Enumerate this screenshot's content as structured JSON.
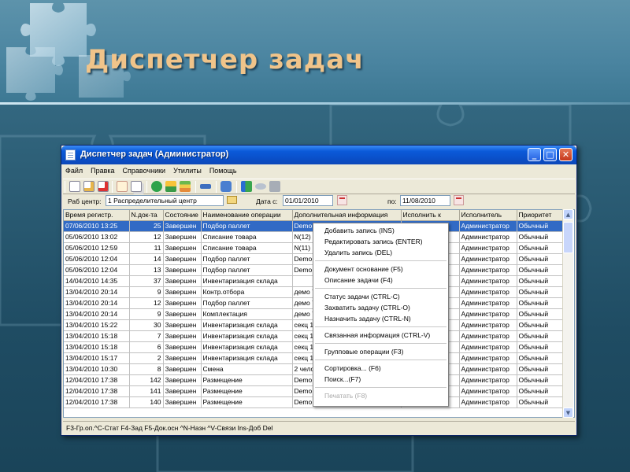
{
  "slide": {
    "title": "Диспетчер задач"
  },
  "window": {
    "title": "Диспетчер задач (Администратор)",
    "controls": {
      "minimize": "_",
      "maximize": "□",
      "close": "✕"
    }
  },
  "menubar": [
    "Файл",
    "Правка",
    "Справочники",
    "Утилиты",
    "Помощь"
  ],
  "toolbar": {
    "icons": [
      "new-doc-icon",
      "edit-doc-icon",
      "delete-doc-icon",
      "doc-base-icon",
      "copy-icon",
      "check-icon",
      "status-icon",
      "task-stack-icon",
      "link-icon",
      "group-icon",
      "sort-icon",
      "view-icon",
      "print-icon"
    ]
  },
  "filters": {
    "work_center_label": "Раб центр:",
    "work_center_value": "1 Распределительный центр",
    "date_from_label": "Дата с:",
    "date_from_value": "01/01/2010",
    "date_to_label": "по:",
    "date_to_value": "11/08/2010"
  },
  "grid": {
    "columns": [
      "Время регистр.",
      "N.док-та",
      "Состояние",
      "Наименование операции",
      "Дополнительная информация",
      "Исполнить к",
      "Исполнитель",
      "Приоритет"
    ],
    "rows": [
      [
        "07/06/2010 13:25",
        "25",
        "Завершен",
        "Подбор паллет",
        "Demo",
        "",
        "Администратор",
        "Обычный"
      ],
      [
        "05/06/2010 13:02",
        "12",
        "Завершен",
        "Списание товара",
        "N(12)",
        "",
        "Администратор",
        "Обычный"
      ],
      [
        "05/06/2010 12:59",
        "11",
        "Завершен",
        "Списание товара",
        "N(11)",
        "",
        "Администратор",
        "Обычный"
      ],
      [
        "05/06/2010 12:04",
        "14",
        "Завершен",
        "Подбор паллет",
        "Demo",
        "",
        "Администратор",
        "Обычный"
      ],
      [
        "05/06/2010 12:04",
        "13",
        "Завершен",
        "Подбор паллет",
        "Demo",
        "",
        "Администратор",
        "Обычный"
      ],
      [
        "14/04/2010 14:35",
        "37",
        "Завершен",
        "Инвентаризация склада",
        "",
        "",
        "Администратор",
        "Обычный"
      ],
      [
        "13/04/2010 20:14",
        "9",
        "Завершен",
        "Контр.отбора",
        "демо 7",
        "",
        "Администратор",
        "Обычный"
      ],
      [
        "13/04/2010 20:14",
        "12",
        "Завершен",
        "Подбор паллет",
        "демо 7",
        "",
        "Администратор",
        "Обычный"
      ],
      [
        "13/04/2010 20:14",
        "9",
        "Завершен",
        "Комплектация",
        "демо 7",
        "",
        "Администратор",
        "Обычный"
      ],
      [
        "13/04/2010 15:22",
        "30",
        "Завершен",
        "Инвентаризация склада",
        "секц 1",
        "",
        "Администратор",
        "Обычный"
      ],
      [
        "13/04/2010 15:18",
        "7",
        "Завершен",
        "Инвентаризация склада",
        "секц 1",
        "",
        "Администратор",
        "Обычный"
      ],
      [
        "13/04/2010 15:18",
        "6",
        "Завершен",
        "Инвентаризация склада",
        "секц 1",
        "",
        "Администратор",
        "Обычный"
      ],
      [
        "13/04/2010 15:17",
        "2",
        "Завершен",
        "Инвентаризация склада",
        "секц 1",
        "",
        "Администратор",
        "Обычный"
      ],
      [
        "13/04/2010 10:30",
        "8",
        "Завершен",
        "Смена",
        "2 чело",
        "",
        "Администратор",
        "Обычный"
      ],
      [
        "12/04/2010 17:38",
        "142",
        "Завершен",
        "Размещение",
        "Demo",
        "",
        "Администратор",
        "Обычный"
      ],
      [
        "12/04/2010 17:38",
        "141",
        "Завершен",
        "Размещение",
        "Demo",
        "",
        "Администратор",
        "Обычный"
      ],
      [
        "12/04/2010 17:38",
        "140",
        "Завершен",
        "Размещение",
        "Demo",
        "",
        "Администратор",
        "Обычный"
      ]
    ],
    "selected_row": 0
  },
  "statusbar": {
    "text": "F3-Гр.оп.^С-Стат F4-Зад F5-Док.осн ^N-Назн ^V-Связи Ins-Доб Del"
  },
  "context_menu": {
    "groups": [
      [
        {
          "label": "Добавить запись (INS)"
        },
        {
          "label": "Редактировать запись (ENTER)"
        },
        {
          "label": "Удалить запись (DEL)"
        }
      ],
      [
        {
          "label": "Документ основание (F5)"
        },
        {
          "label": "Описание задачи (F4)"
        }
      ],
      [
        {
          "label": "Статус задачи (CTRL-C)"
        },
        {
          "label": "Захватить задачу (CTRL-O)"
        },
        {
          "label": "Назначить задачу (CTRL-N)"
        }
      ],
      [
        {
          "label": "Связанная информация (CTRL-V)"
        }
      ],
      [
        {
          "label": "Групповые операции (F3)"
        }
      ],
      [
        {
          "label": "Сортировка... (F6)"
        },
        {
          "label": "Поиск...(F7)"
        }
      ],
      [
        {
          "label": "Печатать (F8)",
          "disabled": true
        }
      ]
    ]
  },
  "colors": {
    "selection": "#316ac5",
    "title_accent": "#f0c48a",
    "titlebar": "#0a4fc8"
  }
}
